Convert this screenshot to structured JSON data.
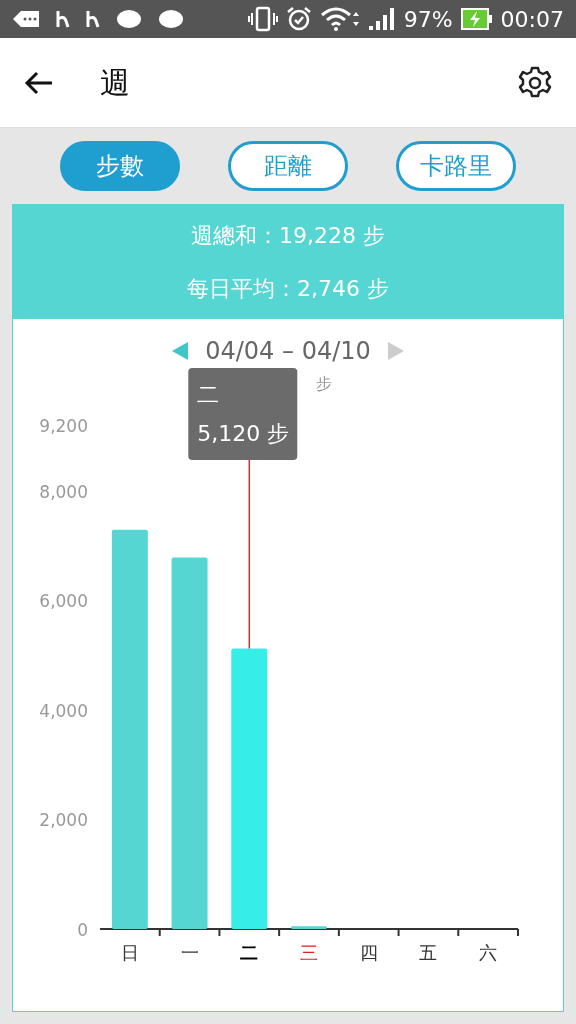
{
  "status_bar": {
    "battery": "97%",
    "time": "00:07"
  },
  "app_bar": {
    "title": "週"
  },
  "tabs": [
    {
      "label": "步數",
      "selected": true
    },
    {
      "label": "距離",
      "selected": false
    },
    {
      "label": "卡路里",
      "selected": false
    }
  ],
  "summary": [
    "週總和：19,228 步",
    "每日平均：2,746 步"
  ],
  "range": {
    "label": "04/04 – 04/10"
  },
  "days": [
    {
      "selected": false,
      "today": false
    },
    {
      "selected": false,
      "today": false
    },
    {
      "selected": true,
      "today": false
    },
    {
      "selected": false,
      "today": true
    },
    {
      "selected": false,
      "today": false
    },
    {
      "selected": false,
      "today": false
    },
    {
      "selected": false,
      "today": false
    }
  ],
  "tooltip": {
    "title": "二",
    "text": "5,120 步"
  },
  "chart_data": {
    "type": "bar",
    "ylabel": "步",
    "categories": [
      "日",
      "一",
      "二",
      "三",
      "四",
      "五",
      "六"
    ],
    "series": [
      {
        "color": "#56d6d2",
        "values": [
          7290,
          6780,
          5120,
          50,
          null,
          null,
          null
        ]
      }
    ],
    "ylim": [
      0,
      9200
    ],
    "yticks": [
      0,
      {
        "value": 2000,
        "label": "2,000"
      },
      {
        "value": 4000,
        "label": "4,000"
      },
      {
        "value": 6000,
        "label": "6,000"
      },
      {
        "value": 8000,
        "label": "8,000"
      },
      {
        "value": 9200,
        "label": "9,200"
      }
    ]
  }
}
